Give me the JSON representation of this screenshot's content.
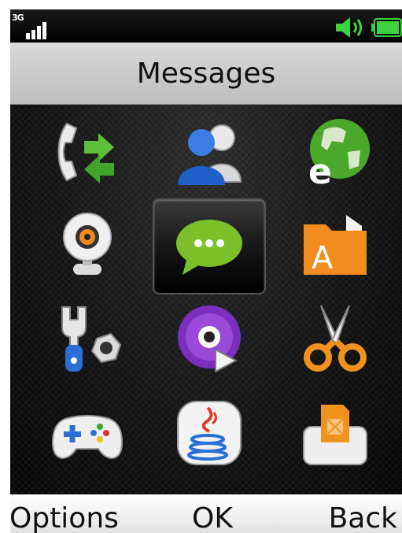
{
  "status_bar": {
    "network": "3G",
    "signal_icon": "signal-bars-icon",
    "volume_icon": "speaker-icon",
    "battery_icon": "battery-icon",
    "colors": {
      "accent": "#33cc33"
    }
  },
  "header": {
    "title": "Messages"
  },
  "menu": {
    "selected_index": 4,
    "items": [
      {
        "icon": "call-log-icon"
      },
      {
        "icon": "contacts-icon"
      },
      {
        "icon": "browser-icon"
      },
      {
        "icon": "webcam-icon"
      },
      {
        "icon": "messages-icon"
      },
      {
        "icon": "files-icon"
      },
      {
        "icon": "settings-icon"
      },
      {
        "icon": "media-player-icon"
      },
      {
        "icon": "tools-icon"
      },
      {
        "icon": "games-icon"
      },
      {
        "icon": "java-icon"
      },
      {
        "icon": "sim-toolkit-icon"
      }
    ]
  },
  "softkeys": {
    "left": "Options",
    "middle": "OK",
    "right": "Back"
  }
}
